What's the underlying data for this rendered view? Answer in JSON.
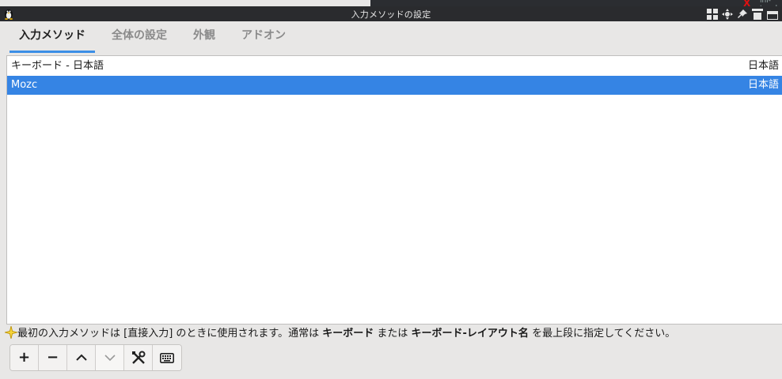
{
  "window": {
    "title": "入力メソッドの設定",
    "background_snippet": "ini-tsugh.rom"
  },
  "tabs": [
    {
      "label": "入力メソッド",
      "active": true
    },
    {
      "label": "全体の設定",
      "active": false
    },
    {
      "label": "外観",
      "active": false
    },
    {
      "label": "アドオン",
      "active": false
    }
  ],
  "methods": [
    {
      "name": "キーボード - 日本語",
      "language": "日本語",
      "selected": false
    },
    {
      "name": "Mozc",
      "language": "日本語",
      "selected": true
    }
  ],
  "hint": {
    "part1": "最初の入力メソッドは [直接入力] のときに使用されます。通常は ",
    "bold1": "キーボード",
    "part2": " または ",
    "bold2": "キーボード-レイアウト名",
    "part3": " を最上段に指定してください。"
  },
  "toolbar": {
    "add_label": "+",
    "remove_label": "−"
  },
  "colors": {
    "accent": "#3584e4",
    "titlebar": "#2a2b2e"
  }
}
